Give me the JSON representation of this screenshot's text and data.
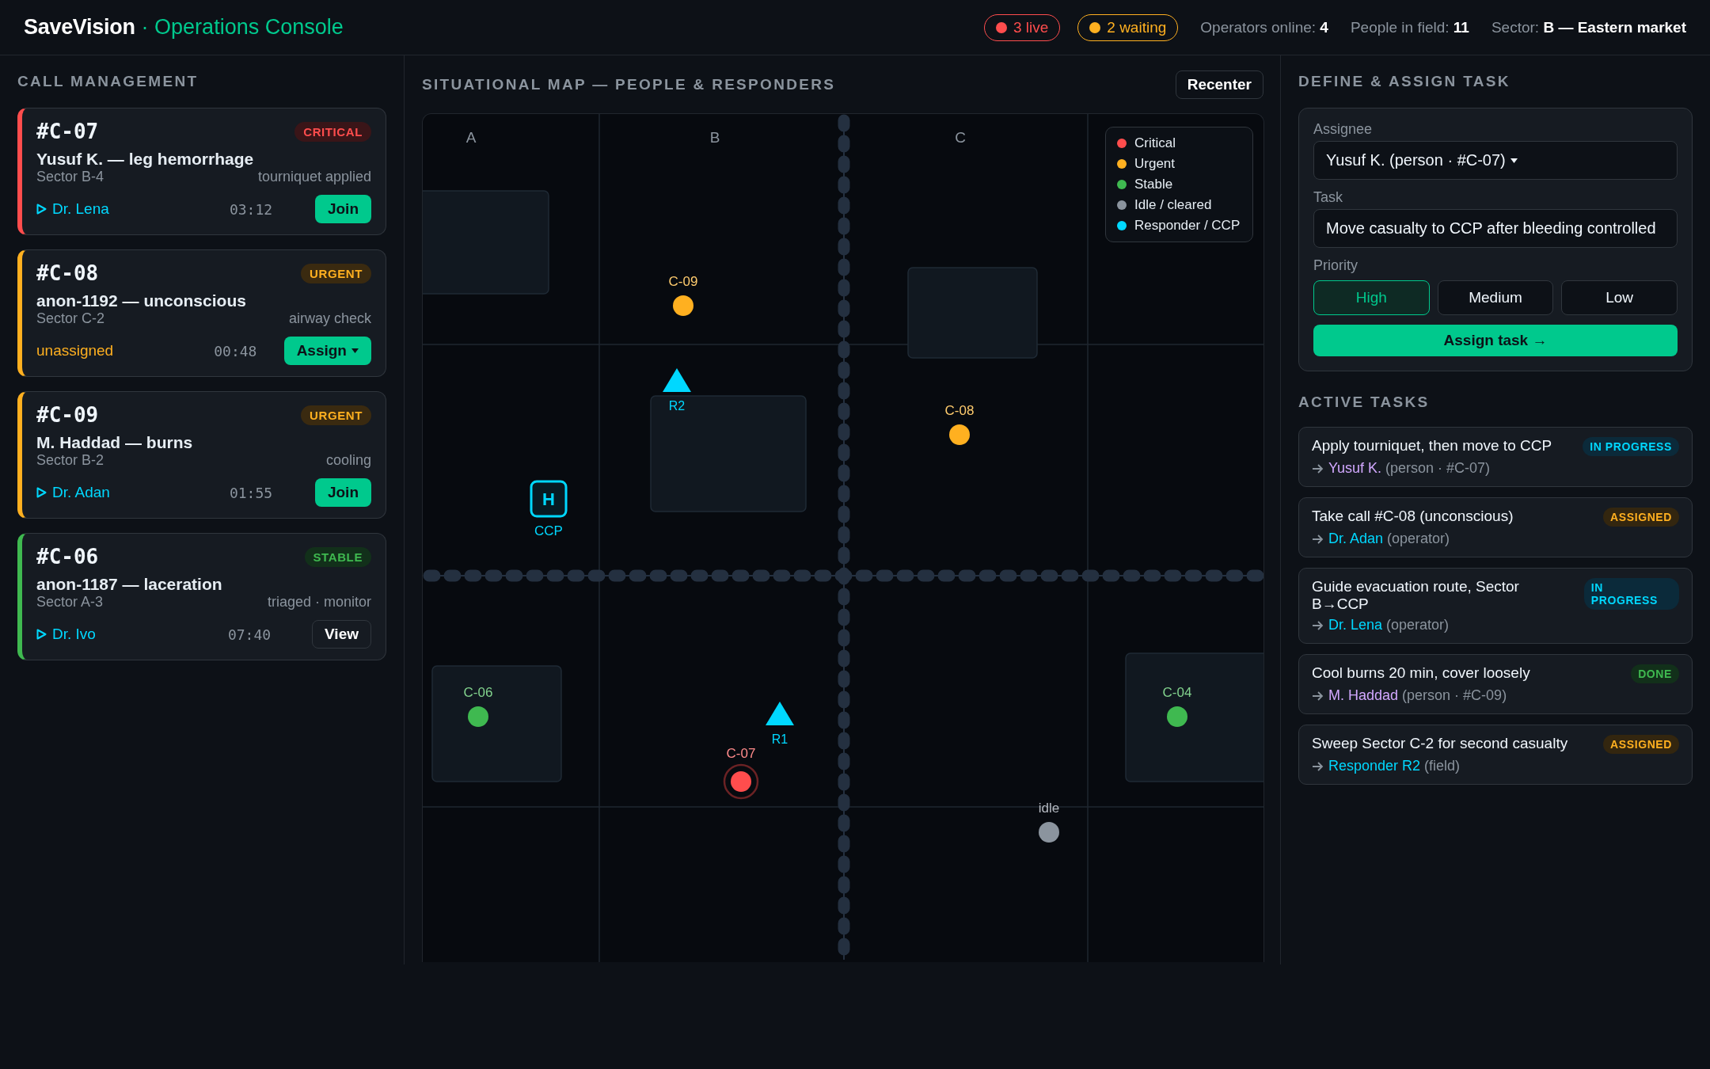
{
  "header": {
    "brand": "SaveVision",
    "subtitle": "· Operations Console",
    "badges": [
      {
        "label": "3 live",
        "color": "#ff4d4d"
      },
      {
        "label": "2 waiting",
        "color": "#ffb020"
      }
    ],
    "stats": [
      {
        "label": "Operators online:",
        "value": "4"
      },
      {
        "label": "People in field:",
        "value": "11"
      },
      {
        "label": "Sector:",
        "value": "B — Eastern market"
      }
    ]
  },
  "calls": {
    "title": "CALL MANAGEMENT",
    "items": [
      {
        "id": "#C-07",
        "kind": "critical",
        "badge": "CRITICAL",
        "title": "Yusuf K. — leg hemorrhage",
        "sector": "Sector B-4",
        "note": "tourniquet applied",
        "assigned": true,
        "assignee": "Dr. Lena",
        "timer": "03:12",
        "action": {
          "label": "Join",
          "kind": "primary",
          "caret": false
        }
      },
      {
        "id": "#C-08",
        "kind": "urgent",
        "badge": "URGENT",
        "title": "anon-1192 — unconscious",
        "sector": "Sector C-2",
        "note": "airway check",
        "assigned": false,
        "assignee": "unassigned",
        "timer": "00:48",
        "action": {
          "label": "Assign",
          "kind": "primary",
          "caret": true
        }
      },
      {
        "id": "#C-09",
        "kind": "urgent",
        "badge": "URGENT",
        "title": "M. Haddad — burns",
        "sector": "Sector B-2",
        "note": "cooling",
        "assigned": true,
        "assignee": "Dr. Adan",
        "timer": "01:55",
        "action": {
          "label": "Join",
          "kind": "primary",
          "caret": false
        }
      },
      {
        "id": "#C-06",
        "kind": "stable",
        "badge": "STABLE",
        "title": "anon-1187 — laceration",
        "sector": "Sector A-3",
        "note": "triaged · monitor",
        "assigned": true,
        "assignee": "Dr. Ivo",
        "timer": "07:40",
        "action": {
          "label": "View",
          "kind": "outline",
          "caret": false
        }
      }
    ]
  },
  "map": {
    "title": "SITUATIONAL MAP — PEOPLE & RESPONDERS",
    "recenter": "Recenter",
    "columns": [
      "A",
      "B",
      "C"
    ],
    "legend": [
      {
        "label": "Critical",
        "color": "#ff4d4d"
      },
      {
        "label": "Urgent",
        "color": "#ffb020"
      },
      {
        "label": "Stable",
        "color": "#3fb950"
      },
      {
        "label": "Idle / cleared",
        "color": "#8b949e"
      },
      {
        "label": "Responder / CCP",
        "color": "#00d8ff"
      }
    ],
    "markers": [
      {
        "kind": "casualty",
        "label": "C-09",
        "color": "#ffb020",
        "critical": false
      },
      {
        "kind": "responder",
        "label": "R2",
        "color": "#00d8ff"
      },
      {
        "kind": "casualty",
        "label": "C-08",
        "color": "#ffb020",
        "critical": false
      },
      {
        "kind": "ccp",
        "symbol": "H",
        "label": "CCP",
        "color": "#00d8ff"
      },
      {
        "kind": "casualty",
        "label": "C-06",
        "color": "#3fb950",
        "critical": false
      },
      {
        "kind": "casualty",
        "label": "C-04",
        "color": "#3fb950",
        "critical": false
      },
      {
        "kind": "responder",
        "label": "R1",
        "color": "#00d8ff"
      },
      {
        "kind": "casualty",
        "label": "C-07",
        "color": "#ff4d4d",
        "critical": true
      },
      {
        "kind": "casualty",
        "label": "idle",
        "color": "#8b949e",
        "critical": false
      }
    ]
  },
  "assign": {
    "title": "DEFINE & ASSIGN TASK",
    "assignee": {
      "label": "Assignee",
      "value": "Yusuf K. (person · #C-07)",
      "caret": true
    },
    "task": {
      "label": "Task",
      "value": "Move casualty to CCP after bleeding controlled"
    },
    "priority": {
      "label": "Priority",
      "options": [
        {
          "label": "High",
          "selected": true
        },
        {
          "label": "Medium",
          "selected": false
        },
        {
          "label": "Low",
          "selected": false
        }
      ]
    },
    "submit": "Assign task →"
  },
  "tasks": {
    "title": "ACTIVE TASKS",
    "items": [
      {
        "title": "Apply tourniquet, then move to CCP",
        "kind": "in_progress",
        "status_label": "IN PROGRESS",
        "assignee": {
          "name": "Yusuf K.",
          "color": "#d2a8ff"
        },
        "detail": "(person · #C-07)"
      },
      {
        "title": "Take call #C-08 (unconscious)",
        "kind": "assigned",
        "status_label": "ASSIGNED",
        "assignee": {
          "name": "Dr. Adan",
          "color": "#00d8ff"
        },
        "detail": "(operator)"
      },
      {
        "title": "Guide evacuation route, Sector B→CCP",
        "kind": "in_progress",
        "status_label": "IN PROGRESS",
        "assignee": {
          "name": "Dr. Lena",
          "color": "#00d8ff"
        },
        "detail": "(operator)"
      },
      {
        "title": "Cool burns 20 min, cover loosely",
        "kind": "done",
        "status_label": "DONE",
        "assignee": {
          "name": "M. Haddad",
          "color": "#d2a8ff"
        },
        "detail": "(person · #C-09)"
      },
      {
        "title": "Sweep Sector C-2 for second casualty",
        "kind": "assigned",
        "status_label": "ASSIGNED",
        "assignee": {
          "name": "Responder R2",
          "color": "#00d8ff"
        },
        "detail": "(field)"
      }
    ]
  }
}
